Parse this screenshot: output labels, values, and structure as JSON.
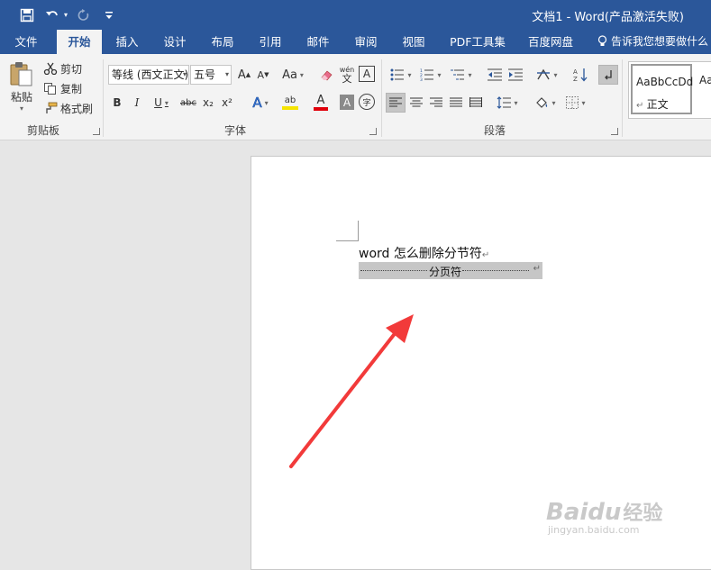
{
  "window": {
    "title": "文档1 - Word(产品激活失败)"
  },
  "tabs": [
    "文件",
    "开始",
    "插入",
    "设计",
    "布局",
    "引用",
    "邮件",
    "审阅",
    "视图",
    "PDF工具集",
    "百度网盘"
  ],
  "active_tab": "开始",
  "tell_me": "告诉我您想要做什么",
  "clipboard": {
    "paste": "粘贴",
    "cut": "剪切",
    "copy": "复制",
    "format_painter": "格式刷",
    "label": "剪贴板"
  },
  "font": {
    "name": "等线 (西文正文)",
    "size": "五号",
    "grow": "A",
    "shrink": "A",
    "change_case": "Aa",
    "pinyin_top": "wén",
    "pinyin_bottom": "文",
    "char_border": "A",
    "bold": "B",
    "italic": "I",
    "underline": "U",
    "strikethrough": "abc",
    "subscript": "x₂",
    "superscript": "x²",
    "text_effects": "A",
    "highlight": "ab",
    "font_color": "A",
    "char_shading": "A",
    "enclose": "字",
    "label": "字体",
    "highlight_color": "#f5e400",
    "font_color_value": "#e0000b"
  },
  "paragraph": {
    "label": "段落"
  },
  "styles": {
    "normal_sample": "AaBbCcDd",
    "normal_name": "正文",
    "next_sample": "Aa"
  },
  "document": {
    "line1": "word 怎么删除分节符",
    "page_break_label": "分页符",
    "para_mark": "↵"
  },
  "watermark": {
    "brand": "Baidu",
    "jingyan": "经验",
    "url": "jingyan.baidu.com"
  },
  "colors": {
    "accent": "#2b579a",
    "arrow": "#f23a3a"
  }
}
